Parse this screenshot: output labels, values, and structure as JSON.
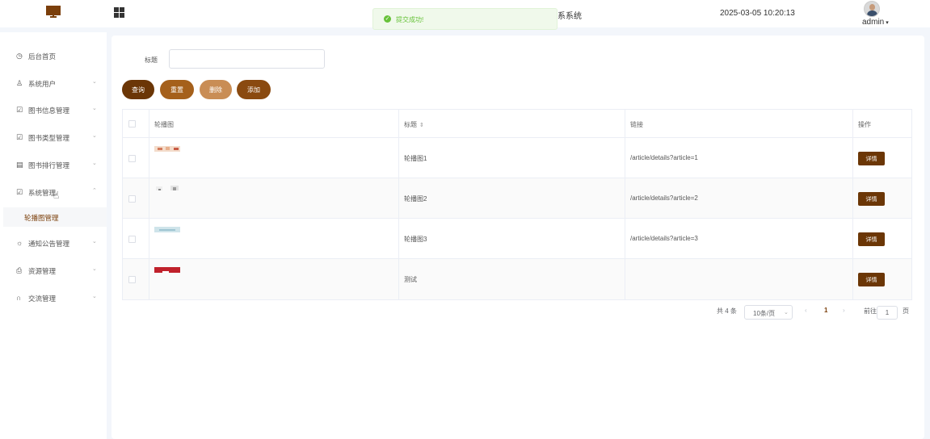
{
  "header": {
    "title_fragment": "系系统",
    "datetime": "2025-03-05 10:20:13",
    "user": "admin"
  },
  "toast": {
    "message": "提交成功!"
  },
  "sidebar": {
    "items": [
      {
        "label": "后台首页",
        "icon": "clock-icon"
      },
      {
        "label": "系统用户",
        "icon": "user-icon"
      },
      {
        "label": "图书信息管理",
        "icon": "chart-icon"
      },
      {
        "label": "图书类型管理",
        "icon": "chart-icon"
      },
      {
        "label": "图书排行管理",
        "icon": "list-icon"
      },
      {
        "label": "系统管理",
        "icon": "chart-icon"
      },
      {
        "label": "通知公告管理",
        "icon": "sun-icon"
      },
      {
        "label": "资源管理",
        "icon": "printer-icon"
      },
      {
        "label": "交流管理",
        "icon": "headset-icon"
      }
    ],
    "sub_item": "轮播图管理"
  },
  "search": {
    "label": "标题",
    "value": ""
  },
  "buttons": {
    "query": "查询",
    "reset": "重置",
    "delete": "删除",
    "add": "添加"
  },
  "colors": {
    "query": "#6b3606",
    "reset": "#a5601b",
    "delete": "#c98d55",
    "add": "#8a4a10",
    "detail": "#6b3606",
    "accent": "#7b3f0b"
  },
  "table": {
    "headers": [
      "轮播图",
      "标题",
      "链接",
      "操作"
    ],
    "rows": [
      {
        "title": "轮播图1",
        "link": "/article/details?article=1",
        "action": "详情"
      },
      {
        "title": "轮播图2",
        "link": "/article/details?article=2",
        "action": "详情"
      },
      {
        "title": "轮播图3",
        "link": "/article/details?article=3",
        "action": "详情"
      },
      {
        "title": "测试",
        "link": "",
        "action": "详情"
      }
    ]
  },
  "pagination": {
    "total": "共 4 条",
    "page_size": "10条/页",
    "prev": "‹",
    "page": "1",
    "next": "›",
    "goto_label": "前往",
    "goto_value": "1",
    "page_unit": "页"
  }
}
